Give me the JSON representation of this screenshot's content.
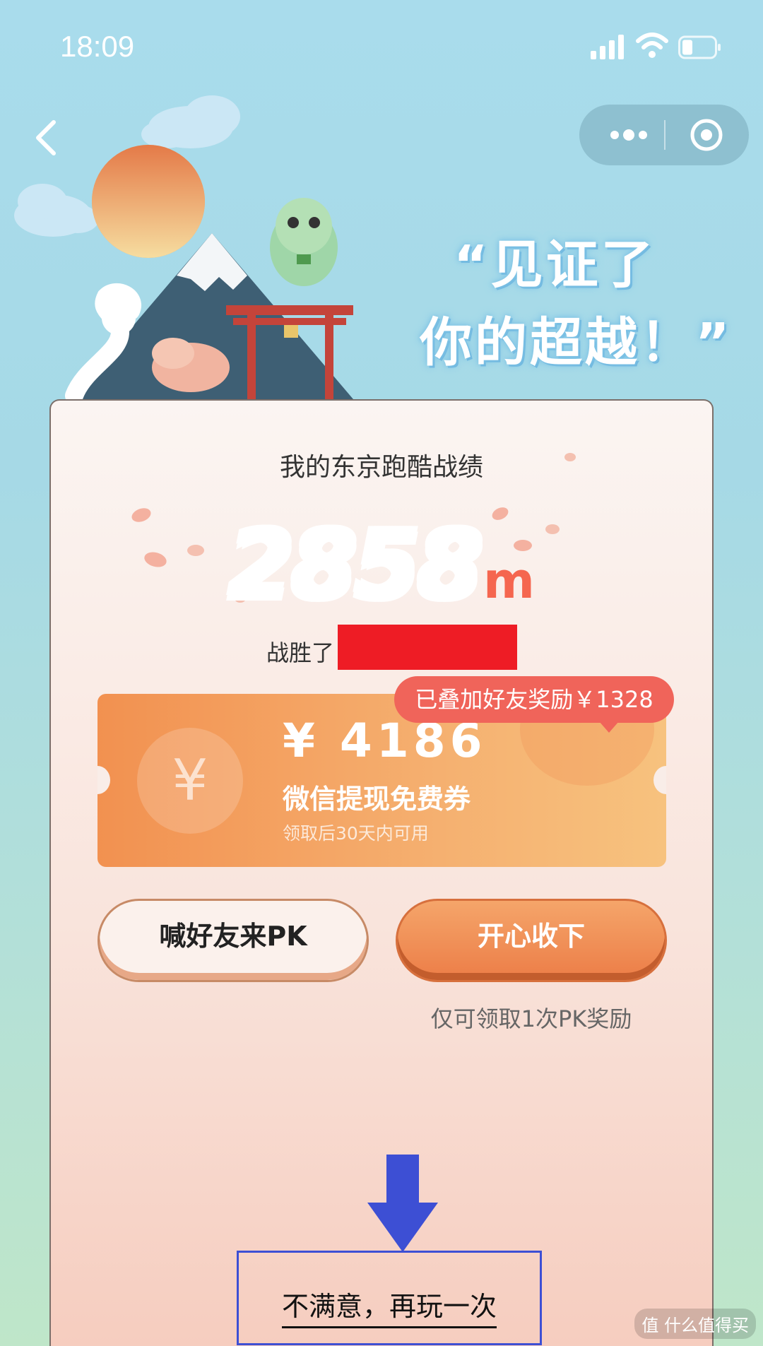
{
  "status_bar": {
    "time": "18:09"
  },
  "slogan": {
    "line1": "“见证了",
    "line2": "你的超越！”"
  },
  "card": {
    "title": "我的东京跑酷战绩",
    "distance_value": "2858",
    "distance_unit": "m",
    "beat_label": "战胜了"
  },
  "reward_tip": "已叠加好友奖励￥1328",
  "voucher": {
    "currency_icon": "¥",
    "amount": "¥ 4186",
    "title": "微信提现免费券",
    "note": "领取后30天内可用"
  },
  "buttons": {
    "pk_label": "喊好友来PK",
    "accept_label": "开心收下",
    "accept_note": "仅可领取1次PK奖励"
  },
  "replay_label": "不满意，再玩一次",
  "watermark": "值 什么值得买",
  "colors": {
    "accent_red": "#f0645a",
    "voucher_orange": "#f29150",
    "annotation_blue": "#3d4fd4"
  }
}
